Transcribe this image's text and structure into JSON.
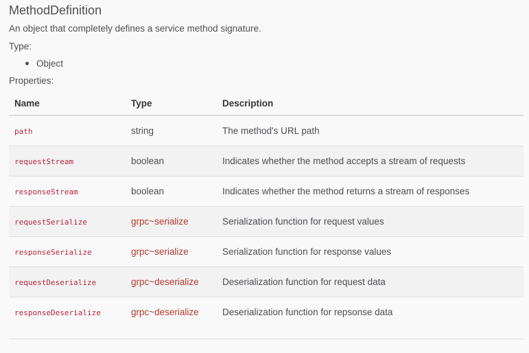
{
  "doc": {
    "title": "MethodDefinition",
    "description": "An object that completely defines a service method signature.",
    "type_heading": "Type:",
    "types": [
      "Object"
    ],
    "properties_heading": "Properties:"
  },
  "table": {
    "headers": {
      "name": "Name",
      "type": "Type",
      "description": "Description"
    },
    "rows": [
      {
        "name": "path",
        "type": "string",
        "type_is_link": false,
        "description": "The method's URL path"
      },
      {
        "name": "requestStream",
        "type": "boolean",
        "type_is_link": false,
        "description": "Indicates whether the method accepts a stream of requests"
      },
      {
        "name": "responseStream",
        "type": "boolean",
        "type_is_link": false,
        "description": "Indicates whether the method returns a stream of responses"
      },
      {
        "name": "requestSerialize",
        "type": "grpc~serialize",
        "type_is_link": true,
        "description": "Serialization function for request values"
      },
      {
        "name": "responseSerialize",
        "type": "grpc~serialize",
        "type_is_link": true,
        "description": "Serialization function for response values"
      },
      {
        "name": "requestDeserialize",
        "type": "grpc~deserialize",
        "type_is_link": true,
        "description": "Deserialization function for request data"
      },
      {
        "name": "responseDeserialize",
        "type": "grpc~deserialize",
        "type_is_link": true,
        "description": "Deserialization function for repsonse data"
      }
    ]
  },
  "colors": {
    "text": "#4d4e53",
    "code": "#b5253f",
    "link": "#b03a2e",
    "stripe": "#f2f2f2",
    "background": "#f9f9f9"
  }
}
